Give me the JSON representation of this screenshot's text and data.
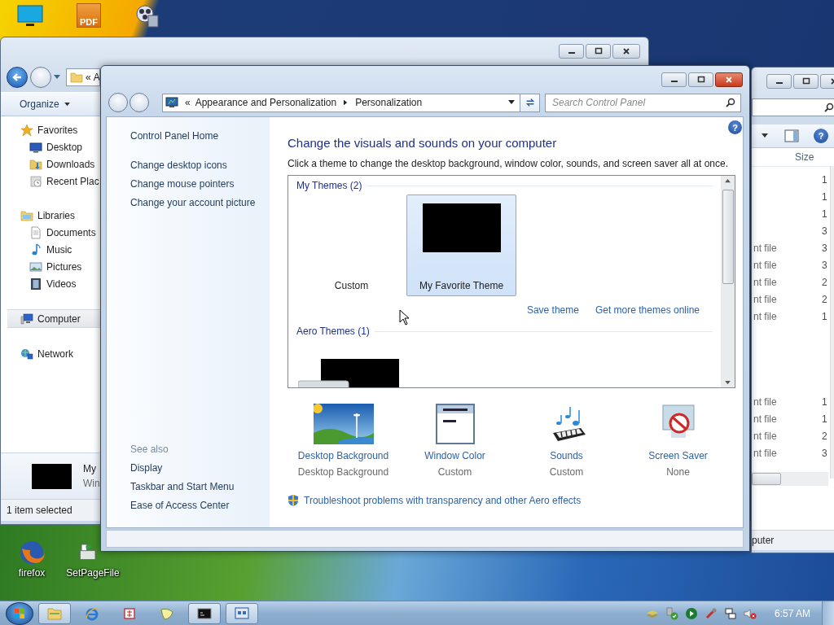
{
  "desktop": {
    "top_icons": [
      {
        "kind": "monitor"
      },
      {
        "kind": "pdf",
        "text": "PDF"
      },
      {
        "kind": "media"
      }
    ],
    "bottom_icons": [
      {
        "kind": "firefox",
        "label": "firefox"
      },
      {
        "kind": "installer",
        "label": "SetPageFile"
      }
    ]
  },
  "explorer_left": {
    "address": {
      "prefix": "«",
      "text": "A"
    },
    "toolbar": {
      "organize": "Organize"
    },
    "nav_tree": [
      {
        "label": "Favorites",
        "kind": "star",
        "selected": false,
        "children": [
          {
            "label": "Desktop",
            "kind": "desktop",
            "selected": false
          },
          {
            "label": "Downloads",
            "kind": "downloads",
            "selected": false
          },
          {
            "label": "Recent Plac",
            "kind": "recent",
            "selected": false
          }
        ]
      },
      {
        "label": "Libraries",
        "kind": "libraries",
        "selected": false,
        "children": [
          {
            "label": "Documents",
            "kind": "documents",
            "selected": false
          },
          {
            "label": "Music",
            "kind": "music",
            "selected": false
          },
          {
            "label": "Pictures",
            "kind": "pictures",
            "selected": false
          },
          {
            "label": "Videos",
            "kind": "videos",
            "selected": false
          }
        ]
      },
      {
        "label": "Computer",
        "kind": "computer",
        "selected": true
      },
      {
        "label": "Network",
        "kind": "network",
        "selected": false
      }
    ],
    "details": {
      "name": "My",
      "type": "Win"
    },
    "status_bar": "1 item selected"
  },
  "explorer_right": {
    "help": "?",
    "column": "Size",
    "row_groups": [
      [
        {
          "size": "1"
        },
        {
          "size": "1"
        },
        {
          "size": "1"
        },
        {
          "size": "3"
        },
        {
          "type": "nt file",
          "size": "3"
        },
        {
          "type": "nt file",
          "size": "3"
        },
        {
          "type": "nt file",
          "size": "2"
        },
        {
          "type": "nt file",
          "size": "2"
        },
        {
          "type": "nt file",
          "size": "1"
        }
      ],
      [
        {
          "type": "nt file",
          "size": "1"
        },
        {
          "type": "nt file",
          "size": "1"
        },
        {
          "type": "nt file",
          "size": "2"
        },
        {
          "type": "nt file",
          "size": "3"
        }
      ]
    ],
    "status_bar": "puter"
  },
  "personalization": {
    "address": {
      "prefix": "«",
      "segments": [
        "Appearance and Personalization",
        "Personalization"
      ]
    },
    "search": {
      "placeholder": "Search Control Panel"
    },
    "help": "?",
    "sidebar": {
      "home": "Control Panel Home",
      "links": [
        "Change desktop icons",
        "Change mouse pointers",
        "Change your account picture"
      ],
      "see_also": {
        "title": "See also",
        "links": [
          "Display",
          "Taskbar and Start Menu",
          "Ease of Access Center"
        ]
      }
    },
    "heading": "Change the visuals and sounds on your computer",
    "description": "Click a theme to change the desktop background, window color, sounds, and screen saver all at once.",
    "theme_groups": [
      {
        "title": "My Themes (2)",
        "themes": [
          {
            "name": "Custom",
            "kind": "empty",
            "selected": false
          },
          {
            "name": "My Favorite Theme",
            "kind": "dark",
            "selected": true
          }
        ],
        "links": [
          "Save theme",
          "Get more themes online"
        ]
      },
      {
        "title": "Aero Themes (1)",
        "themes": [
          {
            "kind": "aero",
            "selected": false
          }
        ]
      }
    ],
    "settings": [
      {
        "kind": "background",
        "name": "Desktop Background",
        "value": "Desktop Background"
      },
      {
        "kind": "window",
        "name": "Window Color",
        "value": "Custom"
      },
      {
        "kind": "sounds",
        "name": "Sounds",
        "value": "Custom"
      },
      {
        "kind": "screensaver",
        "name": "Screen Saver",
        "value": "None"
      }
    ],
    "troubleshoot": "Troubleshoot problems with transparency and other Aero effects"
  },
  "taskbar": {
    "buttons": [
      {
        "kind": "folder",
        "running": true
      },
      {
        "kind": "browser",
        "running": false
      },
      {
        "kind": "red-app",
        "running": false
      },
      {
        "kind": "bird",
        "running": false
      },
      {
        "kind": "console",
        "running": true
      },
      {
        "kind": "window-app",
        "running": true
      }
    ],
    "tray": [
      {
        "kind": "network-share"
      },
      {
        "kind": "security"
      },
      {
        "kind": "media"
      },
      {
        "kind": "tool"
      },
      {
        "kind": "network"
      },
      {
        "kind": "volume-muted"
      }
    ],
    "clock": "6:57 AM"
  }
}
